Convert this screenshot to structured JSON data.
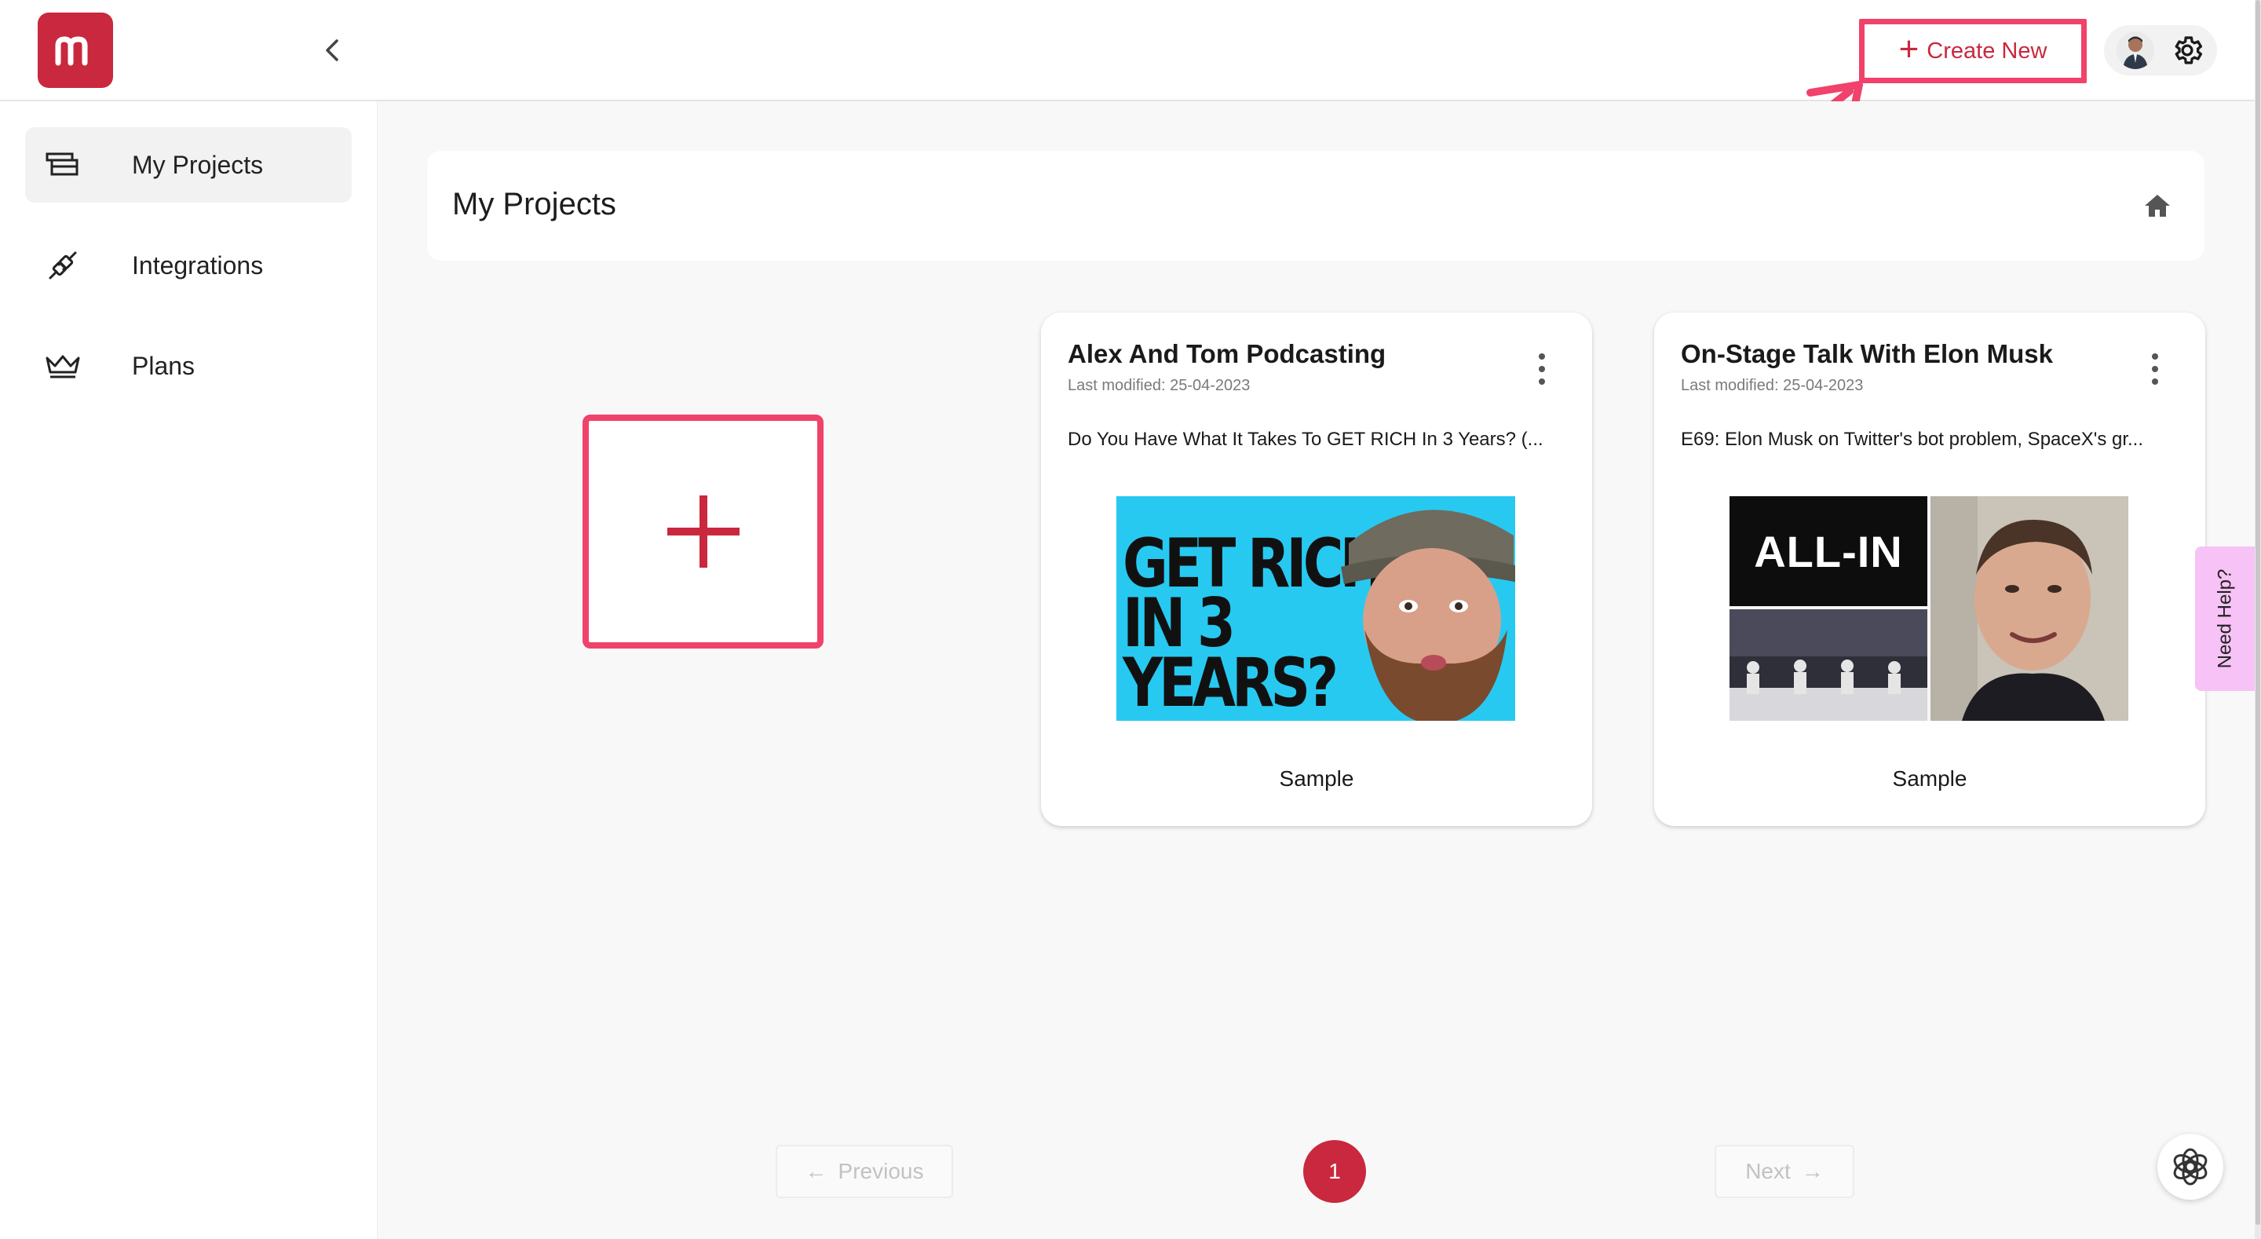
{
  "header": {
    "logo_letter": "m",
    "create_new_label": "Create New"
  },
  "sidebar": {
    "items": [
      {
        "label": "My Projects",
        "icon": "projects-icon",
        "active": true
      },
      {
        "label": "Integrations",
        "icon": "plug-icon",
        "active": false
      },
      {
        "label": "Plans",
        "icon": "crown-icon",
        "active": false
      }
    ]
  },
  "main": {
    "page_title": "My Projects",
    "projects": [
      {
        "title": "Alex And Tom Podcasting",
        "last_modified": "Last modified: 25-04-2023",
        "description": "Do You Have What It Takes To GET RICH In 3 Years? (...",
        "tag": "Sample",
        "thumb_text_line1": "GET RICH",
        "thumb_text_line2": "IN 3 YEARS?"
      },
      {
        "title": "On-Stage Talk With Elon Musk",
        "last_modified": "Last modified: 25-04-2023",
        "description": "E69: Elon Musk on Twitter's bot problem, SpaceX's gr...",
        "tag": "Sample",
        "thumb_text": "ALL-IN"
      }
    ]
  },
  "pagination": {
    "previous_label": "Previous",
    "current_page": "1",
    "next_label": "Next"
  },
  "help": {
    "need_help_label": "Need Help?"
  },
  "colors": {
    "brand": "#c9283e",
    "highlight": "#f0426a",
    "help_tab": "#f7c2f5"
  }
}
